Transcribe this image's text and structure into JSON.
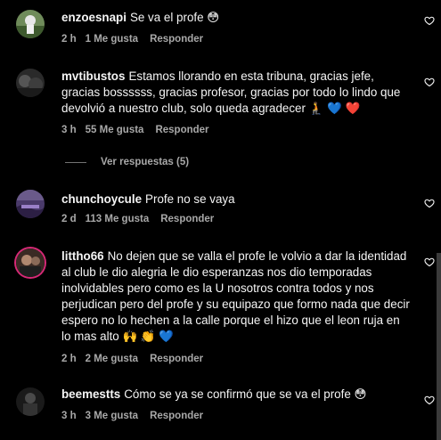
{
  "comments": [
    {
      "username": "enzoesnapi",
      "text": "Se va el profe 😳",
      "time": "2 h",
      "likes": "1 Me gusta",
      "reply": "Responder"
    },
    {
      "username": "mvtibustos",
      "text": "Estamos llorando en esta tribuna, gracias jefe, gracias bossssss, gracias profesor, gracias por todo lo lindo que devolvió a nuestro club, solo queda agradecer 🧎 💙 ❤️",
      "time": "3 h",
      "likes": "55 Me gusta",
      "reply": "Responder",
      "view_replies": "Ver respuestas (5)"
    },
    {
      "username": "chunchoycule",
      "text": "Profe no se vaya",
      "time": "2 d",
      "likes": "113 Me gusta",
      "reply": "Responder"
    },
    {
      "username": "littho66",
      "text": "No dejen que se valla el profe le volvio a dar la identidad al club le dio alegria le dio esperanzas nos dio temporadas inolvidables pero como es la U nosotros contra todos y nos perjudican pero del profe y su equipazo que formo nada que decir espero no lo hechen a la calle porque el hizo que el leon ruja en lo mas alto 🙌 👏 💙",
      "time": "2 h",
      "likes": "2 Me gusta",
      "reply": "Responder"
    },
    {
      "username": "beemestts",
      "text": "Cómo se ya se confirmó que se va el profe 😳",
      "time": "3 h",
      "likes": "3 Me gusta",
      "reply": "Responder"
    }
  ],
  "colors": {
    "background": "#000000",
    "text": "#f5f5f5",
    "muted": "#a8a8a8",
    "story_ring": "#d62976"
  },
  "icons": {
    "like": "heart-outline-icon"
  }
}
